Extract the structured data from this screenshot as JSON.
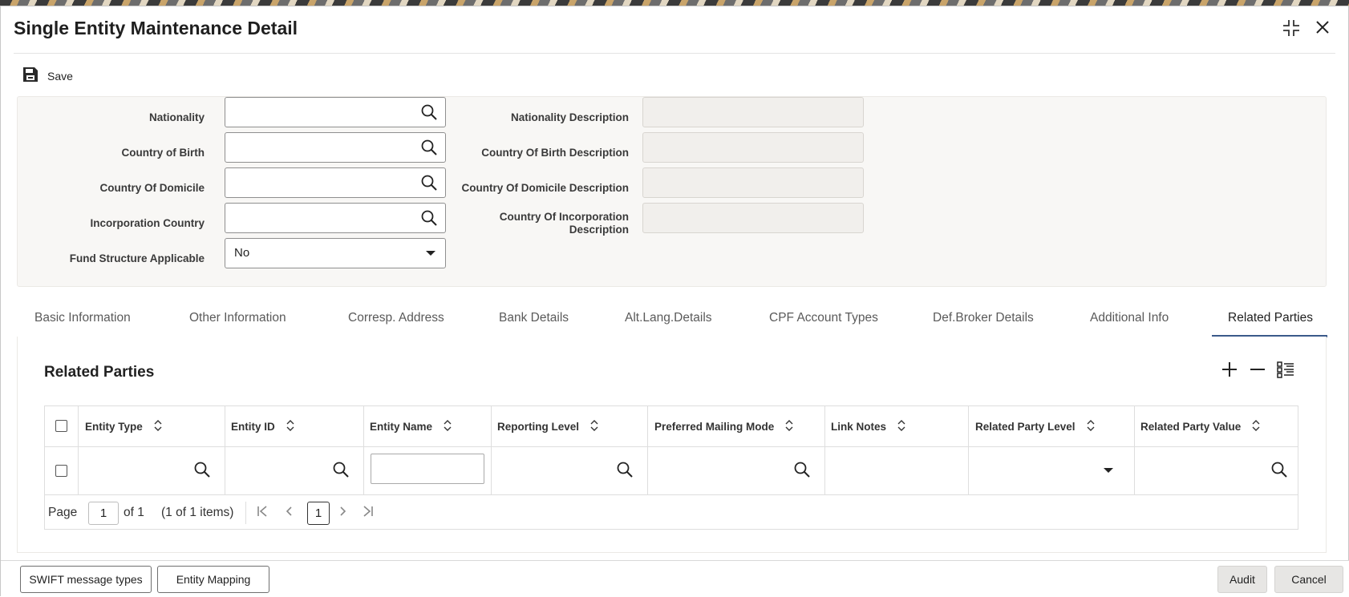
{
  "window": {
    "title": "Single Entity Maintenance Detail"
  },
  "toolbar": {
    "save_label": "Save"
  },
  "form": {
    "nationality_label": "Nationality",
    "country_of_birth_label": "Country of Birth",
    "country_of_domicile_label": "Country Of Domicile",
    "incorporation_country_label": "Incorporation Country",
    "fund_structure_label": "Fund Structure Applicable",
    "fund_structure_value": "No",
    "nationality_desc_label": "Nationality Description",
    "country_of_birth_desc_label": "Country Of Birth Description",
    "country_of_domicile_desc_label": "Country Of Domicile Description",
    "country_of_incorporation_desc_label_1": "Country Of Incorporation",
    "country_of_incorporation_desc_label_2": "Description"
  },
  "tabs": [
    {
      "label": "Basic Information"
    },
    {
      "label": "Other Information"
    },
    {
      "label": "Corresp. Address"
    },
    {
      "label": "Bank Details"
    },
    {
      "label": "Alt.Lang.Details"
    },
    {
      "label": "CPF Account Types"
    },
    {
      "label": "Def.Broker Details"
    },
    {
      "label": "Additional Info"
    },
    {
      "label": "Related Parties"
    }
  ],
  "active_tab": "Related Parties",
  "grid": {
    "title": "Related Parties",
    "columns": [
      {
        "label": "Entity Type"
      },
      {
        "label": "Entity ID"
      },
      {
        "label": "Entity Name"
      },
      {
        "label": "Reporting Level"
      },
      {
        "label": "Preferred Mailing Mode"
      },
      {
        "label": "Link Notes"
      },
      {
        "label": "Related Party Level"
      },
      {
        "label": "Related Party Value"
      }
    ],
    "pager": {
      "page_label": "Page",
      "page_value": "1",
      "of_label": "of 1",
      "items_label": "(1 of 1 items)",
      "current_page": "1"
    }
  },
  "footer": {
    "swift_label": "SWIFT message types",
    "entity_mapping_label": "Entity Mapping",
    "audit_label": "Audit",
    "cancel_label": "Cancel"
  },
  "colors": {
    "accent_underline": "#3b5a8a",
    "panel_bg": "#f8f7f5"
  },
  "icons": [
    "save-icon",
    "search-icon",
    "sort-icon",
    "add-icon",
    "remove-icon",
    "column-settings-icon",
    "restore-icon",
    "close-icon"
  ]
}
